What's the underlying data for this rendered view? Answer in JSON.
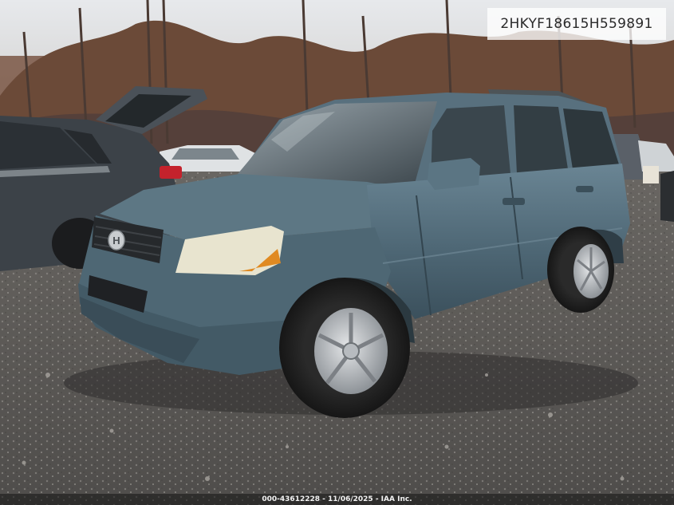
{
  "image": {
    "vin_overlay": "2HKYF18615H559891",
    "footer_caption": "000-43612228 - 11/06/2025 - IAA Inc.",
    "badge_icon": "honda-logo-icon"
  },
  "colors": {
    "sky": "#dcdfe3",
    "trees": "#6b4a38",
    "gravel": "#5e5b58",
    "suv_body": "#4f6877",
    "neighbor_car": "#3c4248"
  }
}
